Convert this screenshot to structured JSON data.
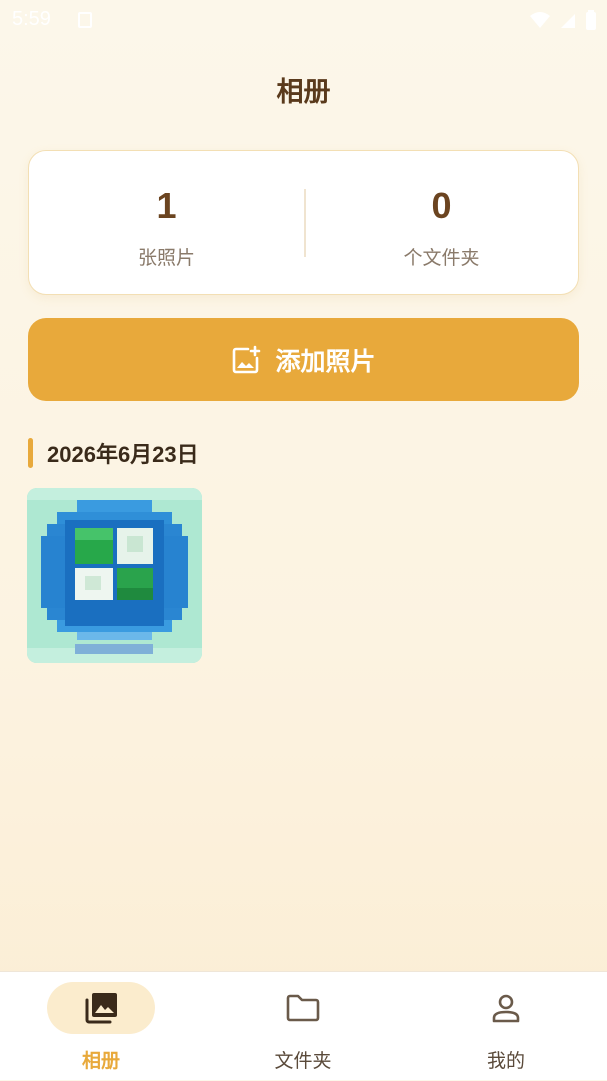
{
  "status_bar": {
    "time": "5:59"
  },
  "header": {
    "title": "相册"
  },
  "stats": {
    "photos": {
      "value": "1",
      "label": "张照片"
    },
    "folders": {
      "value": "0",
      "label": "个文件夹"
    }
  },
  "add_button": {
    "label": "添加照片",
    "icon": "add-photo-icon"
  },
  "sections": [
    {
      "date": "2026年6月23日",
      "photo_count": 1
    }
  ],
  "bottom_nav": {
    "items": [
      {
        "label": "相册",
        "icon": "photo-library-icon",
        "active": true
      },
      {
        "label": "文件夹",
        "icon": "folder-icon",
        "active": false
      },
      {
        "label": "我的",
        "icon": "person-icon",
        "active": false
      }
    ]
  },
  "colors": {
    "accent": "#e8a93b",
    "title": "#5a3a1c",
    "background": "#fcf5e6",
    "active_pill": "#fbeccd"
  }
}
